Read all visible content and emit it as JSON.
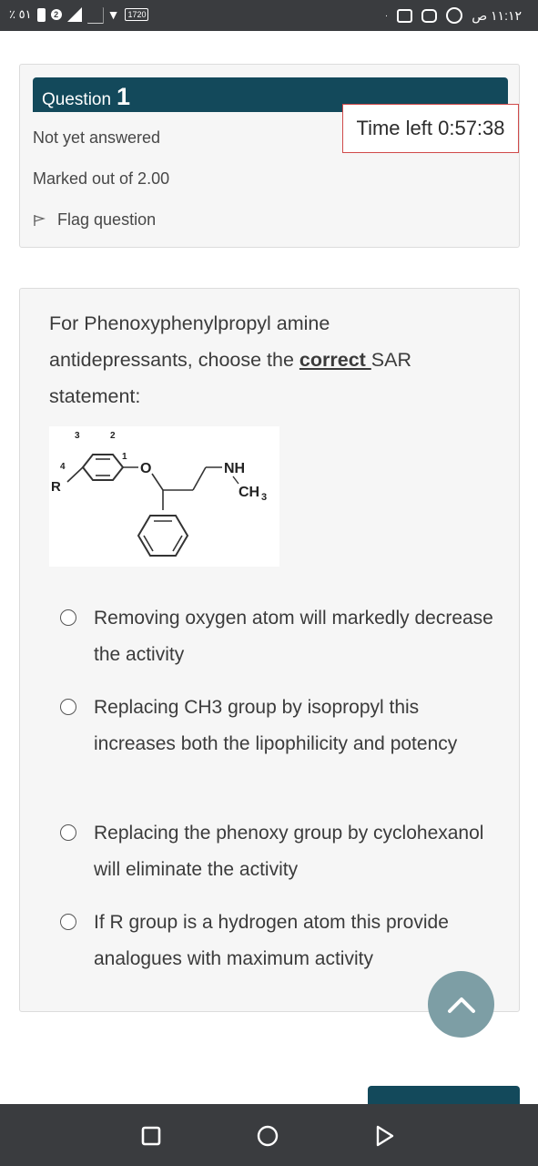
{
  "status_bar": {
    "time": "١١:١٢ ص",
    "battery_percent": "٪ ٥١",
    "sim_badge": "2",
    "hd_label": "1720"
  },
  "info": {
    "question_label": "Question",
    "question_number": "1",
    "status": "Not yet answered",
    "marked_out_of": "Marked out of 2.00",
    "flag_label": "Flag question"
  },
  "timer": {
    "text": "Time left 0:57:38"
  },
  "question": {
    "text_before": "For Phenoxyphenylpropyl amine antidepressants, choose the ",
    "text_strong": "correct ",
    "text_after": "SAR statement:",
    "molecule": {
      "label_3": "3",
      "label_2": "2",
      "label_1": "1",
      "label_4": "4",
      "label_r": "R",
      "label_o": "O",
      "label_nh": "NH",
      "label_ch": "CH",
      "label_sub3": "3"
    },
    "options": [
      {
        "text": "Removing oxygen atom will markedly decrease the activity"
      },
      {
        "text": "Replacing CH3 group by isopropyl this increases both the lipophilicity and potency"
      },
      {
        "text": "Replacing the phenoxy group by cyclohexanol will eliminate the activity"
      },
      {
        "text": "If R group is a hydrogen atom this provide analogues with maximum activity"
      }
    ]
  },
  "colors": {
    "header": "#13495b",
    "timer_border": "#d04a4a",
    "fab": "#7d9ea5",
    "system_bar": "#3a3c3f"
  }
}
